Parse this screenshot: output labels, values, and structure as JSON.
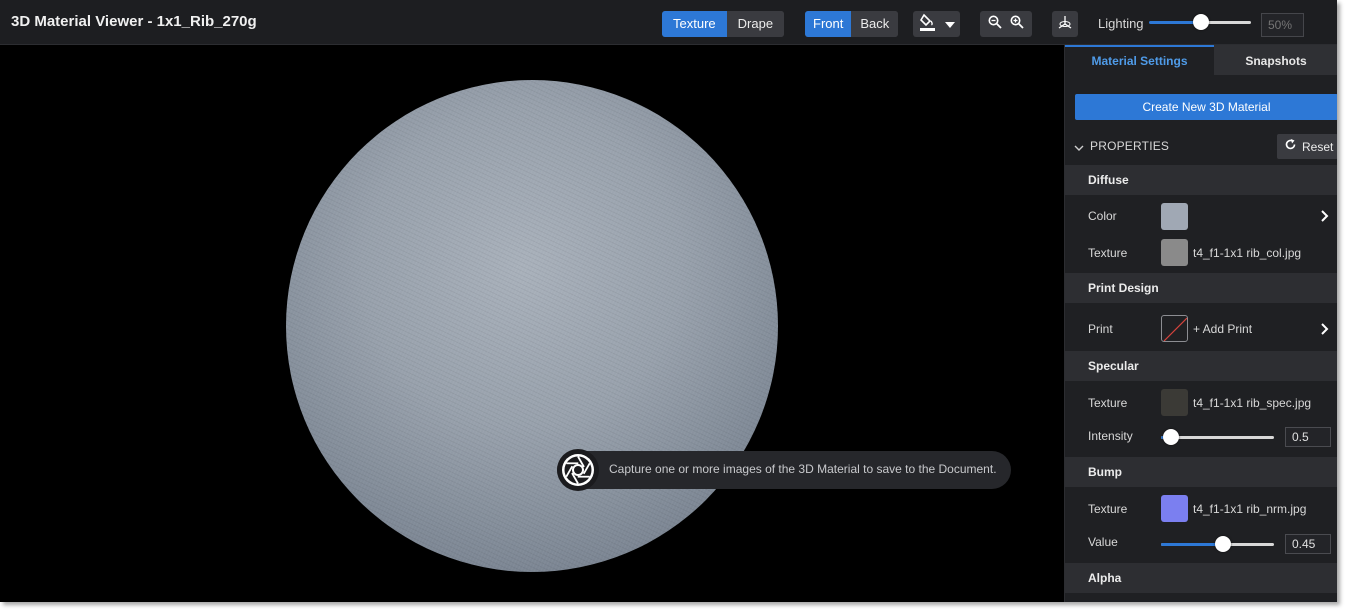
{
  "app": {
    "title": "3D Material Viewer - 1x1_Rib_270g"
  },
  "toolbar": {
    "view_mode": {
      "options": [
        "Texture",
        "Drape"
      ],
      "selected": "Texture"
    },
    "side": {
      "options": [
        "Front",
        "Back"
      ],
      "selected": "Front"
    },
    "fill_icon": "paint-bucket-icon",
    "zoom_out_icon": "zoom-out-icon",
    "zoom_in_icon": "zoom-in-icon",
    "axis_icon": "axis-icon",
    "lighting_label": "Lighting",
    "lighting_value": 0.5,
    "lighting_placeholder": "50%"
  },
  "viewport": {
    "tooltip": "Capture one or more images of the 3D Material to save to the Document.",
    "tooltip_icon": "camera-shutter-icon"
  },
  "panel": {
    "tabs": [
      "Material Settings",
      "Snapshots"
    ],
    "active_tab": "Material Settings",
    "create_button": "Create New 3D Material",
    "properties_label": "PROPERTIES",
    "reset_label": "Reset",
    "sections": {
      "diffuse": {
        "title": "Diffuse",
        "color_label": "Color",
        "color_swatch": "#a0a8b4",
        "texture_label": "Texture",
        "texture_swatch": "#8a8a8a",
        "texture_name": "t4_f1-1x1 rib_col.jpg"
      },
      "print_design": {
        "title": "Print Design",
        "print_label": "Print",
        "add_print": "+ Add Print"
      },
      "specular": {
        "title": "Specular",
        "texture_label": "Texture",
        "texture_swatch": "#3b3a36",
        "texture_name": "t4_f1-1x1 rib_spec.jpg",
        "intensity_label": "Intensity",
        "intensity_value": "0.5"
      },
      "bump": {
        "title": "Bump",
        "texture_label": "Texture",
        "texture_swatch": "#7b7ff0",
        "texture_name": "t4_f1-1x1 rib_nrm.jpg",
        "value_label": "Value",
        "value": "0.45"
      },
      "alpha": {
        "title": "Alpha"
      }
    }
  },
  "colors": {
    "accent": "#2d78d6",
    "background": "#1c1d20"
  }
}
